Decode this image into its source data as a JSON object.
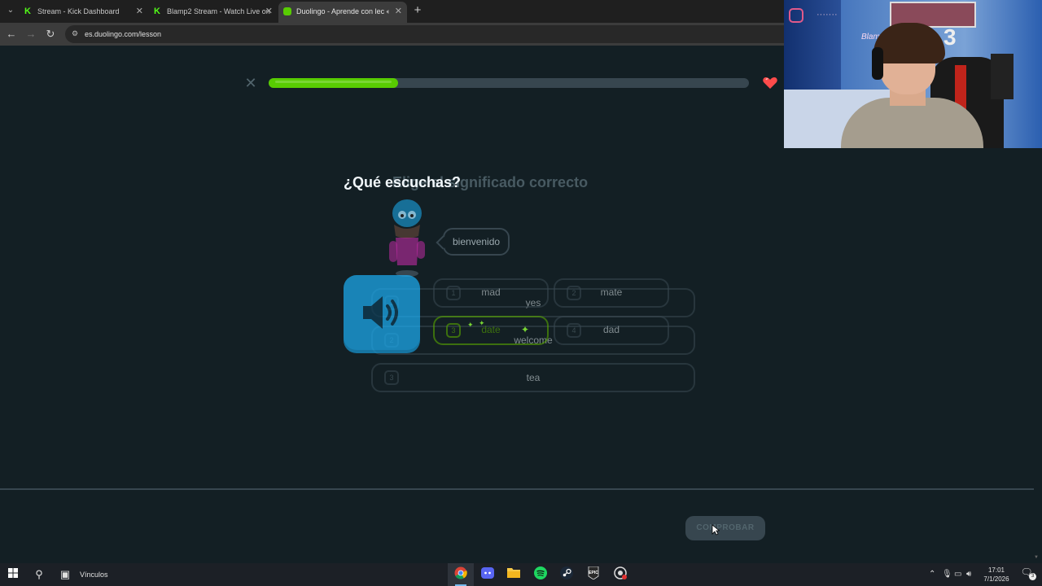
{
  "browser": {
    "tabs": [
      {
        "title": "Stream - Kick Dashboard",
        "icon": "kick-icon",
        "active": false
      },
      {
        "title": "Blamp2 Stream - Watch Live on",
        "icon": "kick-icon",
        "active": false
      },
      {
        "title": "Duolingo - Aprende con lec",
        "icon": "duolingo-icon",
        "active": true
      }
    ],
    "url": "es.duolingo.com/lesson"
  },
  "lesson": {
    "progress_fraction": 0.27,
    "title_question": "¿Qué escuchas?",
    "title_faded": "Elige el significado correcto",
    "speech_bubble": "bienvenido",
    "options_faded": [
      {
        "num": "1",
        "text": "yes"
      },
      {
        "num": "2",
        "text": "welcome"
      },
      {
        "num": "3",
        "text": "tea"
      }
    ],
    "options_grid": [
      {
        "num": "1",
        "text": "mad"
      },
      {
        "num": "2",
        "text": "mate"
      },
      {
        "num": "3",
        "text": "date"
      },
      {
        "num": "4",
        "text": "dad"
      }
    ],
    "check_button": "COMPROBAR"
  },
  "webcam": {
    "neon_sign": "Blamp2",
    "number_sign": "3"
  },
  "taskbar": {
    "links_label": "Vínculos",
    "time": "17:01",
    "date": "7/1/2026",
    "notifications": "3"
  },
  "colors": {
    "progress_green": "#58cc02",
    "speaker_blue": "#1cb0f6",
    "heart_red": "#ff4b4b",
    "bg": "#131f24"
  }
}
